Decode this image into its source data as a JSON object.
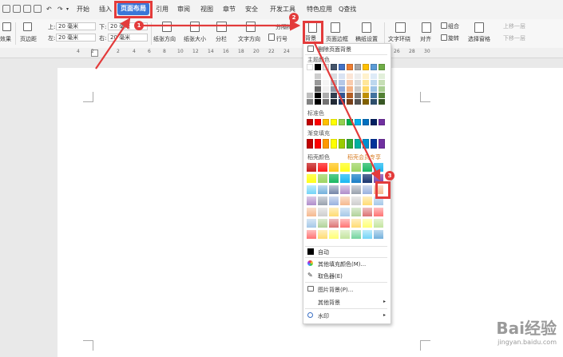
{
  "menu": {
    "tabs": [
      "开始",
      "插入",
      "页面布局",
      "引用",
      "审阅",
      "视图",
      "章节",
      "安全",
      "开发工具",
      "特色应用"
    ],
    "search": "Q查找"
  },
  "ribbon": {
    "effects": "效果",
    "margins": "页边距",
    "top_label": "上:",
    "top_value": "20 毫米",
    "bottom_label": "下:",
    "bottom_value": "20 毫米",
    "left_label": "左:",
    "left_value": "20 毫米",
    "right_label": "右:",
    "right_value": "20 毫米",
    "orientation": "纸张方向",
    "size": "纸张大小",
    "columns": "分栏",
    "text_direction": "文字方向",
    "line_number": "行号",
    "separator": "分隔符",
    "background": "背景",
    "page_border": "页面边框",
    "draft_settings": "稿纸设置",
    "wrap_text": "文字环绕",
    "align": "对齐",
    "rotate": "旋转",
    "group": "组合",
    "select_pane": "选择窗格",
    "bring_forward": "上移一层",
    "send_backward": "下移一层"
  },
  "ruler": {
    "numbers": [
      "4",
      "2",
      "2",
      "4",
      "6",
      "8",
      "10",
      "12",
      "14",
      "16",
      "18",
      "20",
      "22",
      "24",
      "26",
      "28",
      "30"
    ]
  },
  "dropdown": {
    "delete_bg": "删除页面背景",
    "theme_colors": "主题颜色",
    "standard_colors": "标准色",
    "gradient_fill": "渐变填充",
    "texture": "稻壳颜色",
    "texture_promo": "稻壳会员专享",
    "auto": "自动",
    "more_colors": "其他填充颜色(M)...",
    "picker": "取色器(E)",
    "image_bg": "图片背景(P)...",
    "other_bg": "其他背景",
    "watermark": "水印",
    "theme_row": [
      "#ffffff",
      "#000000",
      "#e7e6e6",
      "#44546a",
      "#4472c4",
      "#ed7d31",
      "#a5a5a5",
      "#ffc000",
      "#5b9bd5",
      "#70ad47"
    ],
    "standard_row": [
      "#c00000",
      "#ff0000",
      "#ffc000",
      "#ffff00",
      "#92d050",
      "#00b050",
      "#00b0f0",
      "#0070c0",
      "#002060",
      "#7030a0"
    ],
    "gradient_row": [
      "#c00000",
      "#ff0000",
      "#ff9900",
      "#ffff00",
      "#99cc00",
      "#33aa33",
      "#00b0a0",
      "#0090d0",
      "#003399",
      "#7030a0"
    ],
    "auto_color": "#000000"
  },
  "annotations": {
    "badge1": "1",
    "badge2": "2",
    "badge3": "3",
    "accent": "#e33b3b"
  },
  "watermark": {
    "brand": "Bai经验",
    "url": "jingyan.baidu.com"
  }
}
